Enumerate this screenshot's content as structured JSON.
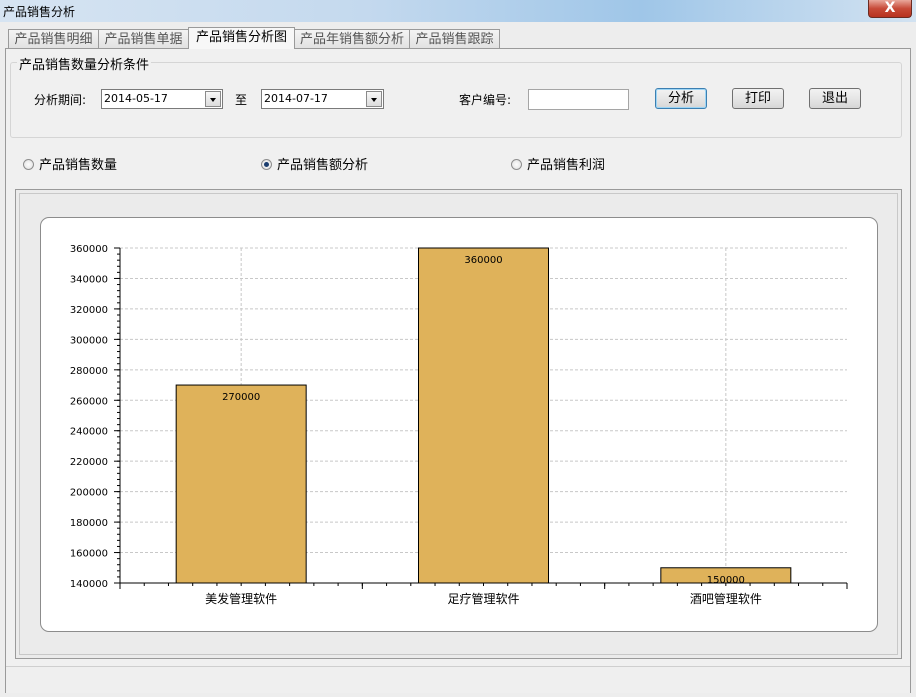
{
  "window": {
    "title": "产品销售分析",
    "close_label": "X"
  },
  "tabs": [
    {
      "label": "产品销售明细"
    },
    {
      "label": "产品销售单据"
    },
    {
      "label": "产品销售分析图",
      "active": true
    },
    {
      "label": "产品年销售额分析"
    },
    {
      "label": "产品销售跟踪"
    }
  ],
  "conditions": {
    "group_title": "产品销售数量分析条件",
    "period_label": "分析期间:",
    "start_date": "2014-05-17",
    "to_label": "至",
    "end_date": "2014-07-17",
    "customer_label": "客户编号:",
    "customer_value": "",
    "analyze_label": "分析",
    "print_label": "打印",
    "exit_label": "退出"
  },
  "radios": [
    {
      "label": "产品销售数量",
      "checked": false
    },
    {
      "label": "产品销售额分析",
      "checked": true
    },
    {
      "label": "产品销售利润",
      "checked": false
    }
  ],
  "chart_data": {
    "type": "bar",
    "categories": [
      "美发管理软件",
      "足疗管理软件",
      "酒吧管理软件"
    ],
    "values": [
      270000,
      360000,
      150000
    ],
    "ylim": [
      140000,
      360000
    ],
    "yticks": [
      "360000",
      "340000",
      "320000",
      "300000",
      "280000",
      "260000",
      "240000",
      "220000",
      "200000",
      "180000",
      "160000",
      "140000"
    ],
    "data_labels": [
      "270000",
      "360000",
      "150000"
    ],
    "grid": true,
    "bar_color": "#dfb25a"
  }
}
